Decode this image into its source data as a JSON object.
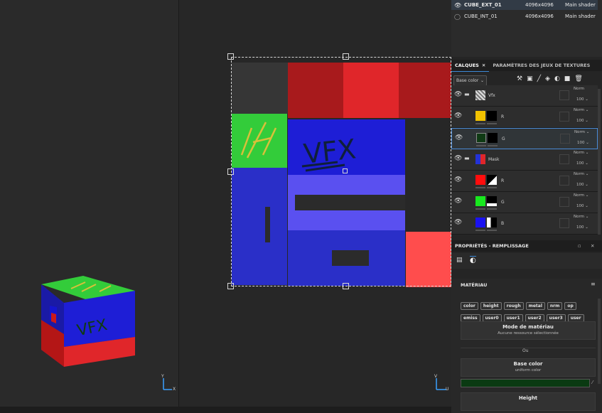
{
  "texture_sets": [
    {
      "name": "CUBE_EXT_01",
      "resolution": "4096x4096",
      "shader": "Main shader"
    },
    {
      "name": "CUBE_INT_01",
      "resolution": "4096x4096",
      "shader": "Main shader"
    }
  ],
  "layers_panel": {
    "tab_layers": "CALQUES",
    "tab_texture_sets": "PARAMÈTRES DES JEUX DE TEXTURES",
    "channel": "Base color",
    "layers": [
      {
        "name": "Vfx",
        "type": "folder",
        "blend": "Norm",
        "opacity": "100",
        "thumb_color": "#bfbfbf"
      },
      {
        "name": "R",
        "type": "fill",
        "blend": "Norm",
        "opacity": "100",
        "thumb_color": "#f2c200"
      },
      {
        "name": "G",
        "type": "fill",
        "blend": "Norm",
        "opacity": "100",
        "thumb_color": "#0f3a14",
        "selected": true
      },
      {
        "name": "Mask",
        "type": "folder",
        "blend": "Norm",
        "opacity": "100",
        "thumb_color": "#2432d6"
      },
      {
        "name": "R",
        "type": "fill",
        "blend": "Norm",
        "opacity": "100",
        "thumb_color": "#ff0d0d"
      },
      {
        "name": "G",
        "type": "fill",
        "blend": "Norm",
        "opacity": "100",
        "thumb_color": "#18e81e"
      },
      {
        "name": "B",
        "type": "fill",
        "blend": "Norm",
        "opacity": "100",
        "thumb_color": "#1a12f0"
      }
    ]
  },
  "properties": {
    "title": "PROPRIÉTÉS - REMPLISSAGE",
    "material_label": "MATÉRIAU",
    "chips_row1": [
      "color",
      "height",
      "rough",
      "metal",
      "nrm",
      "op"
    ],
    "chips_row2": [
      "emiss",
      "user0",
      "user1",
      "user2",
      "user3",
      "user"
    ],
    "mode_title": "Mode de matériau",
    "mode_sub": "Aucune ressource sélectionnée",
    "or_label": "Ou",
    "base_color_title": "Base color",
    "base_color_sub": "uniform color",
    "base_color_value": "#0a3a12",
    "height_title": "Height"
  },
  "viewport_axes": {
    "left_y": "Y",
    "left_x": "X",
    "right_v": "V",
    "right_u": "U"
  },
  "vfx_text": "VFX",
  "colors": {
    "accent": "#3d89d8",
    "uv_red": "#e0262a",
    "uv_blue": "#1e1ed6",
    "uv_green": "#33cc3a",
    "uv_lavender": "#5a50f0"
  }
}
